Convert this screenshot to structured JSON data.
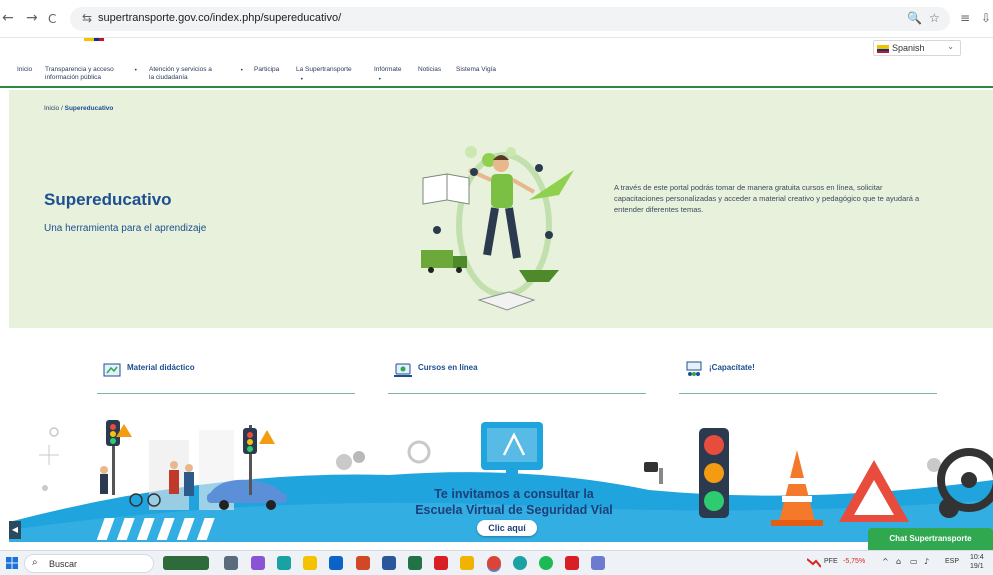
{
  "browser": {
    "back_glyph": "←",
    "forward_glyph": "→",
    "reload_glyph": "C",
    "site_info_glyph": "⇆",
    "url": "supertransporte.gov.co/index.php/supereducativo/",
    "zoom_glyph": "🔍",
    "bookmark_glyph": "☆",
    "reading_glyph": "≡",
    "extensions_glyph": "⇩"
  },
  "header": {
    "language": "Spanish",
    "language_chevron": "⌄"
  },
  "nav": {
    "items": [
      {
        "label": "Inicio"
      },
      {
        "label": "Transparencia y acceso",
        "label2": "información pública"
      },
      {
        "label": "Atención y servicios a",
        "label2": "la ciudadanía"
      },
      {
        "label": "Participa"
      },
      {
        "label": "La Supertransporte"
      },
      {
        "label": "Infórmate"
      },
      {
        "label": "Noticias"
      },
      {
        "label": "Sistema Vigía"
      }
    ],
    "dot": "•"
  },
  "hero": {
    "breadcrumb_home": "Inicio /",
    "breadcrumb_current": "Supereducativo",
    "title": "Supereducativo",
    "subtitle": "Una herramienta para el aprendizaje",
    "description": "A través de este portal podrás tomar de manera gratuita cursos en línea, solicitar capacitaciones personalizadas y acceder a material creativo y pedagógico que te ayudará a entender diferentes temas."
  },
  "cards": [
    {
      "label": "Material didáctico"
    },
    {
      "label": "Cursos en línea"
    },
    {
      "label": "¡Capacítate!"
    }
  ],
  "banner": {
    "line1": "Te invitamos a consultar la",
    "line2": "Escuela Virtual de Seguridad Vial",
    "button": "Clic aquí"
  },
  "chat": {
    "label": "Chat Supertransporte"
  },
  "scroll_glyph": "◀",
  "taskbar": {
    "search_placeholder": "Buscar",
    "search_glyph": "⌕",
    "stock_ticker": "PFE",
    "stock_change": "-5,75%",
    "tray_chevron": "^",
    "language": "ESP",
    "time": "10:4",
    "date": "19/1"
  },
  "colors": {
    "accent_green": "#2fa84f",
    "hero_bg": "#e7f1dc",
    "title_blue": "#1d4f91",
    "banner_blue": "#1fa4dd",
    "stock_red": "#d9251d"
  }
}
